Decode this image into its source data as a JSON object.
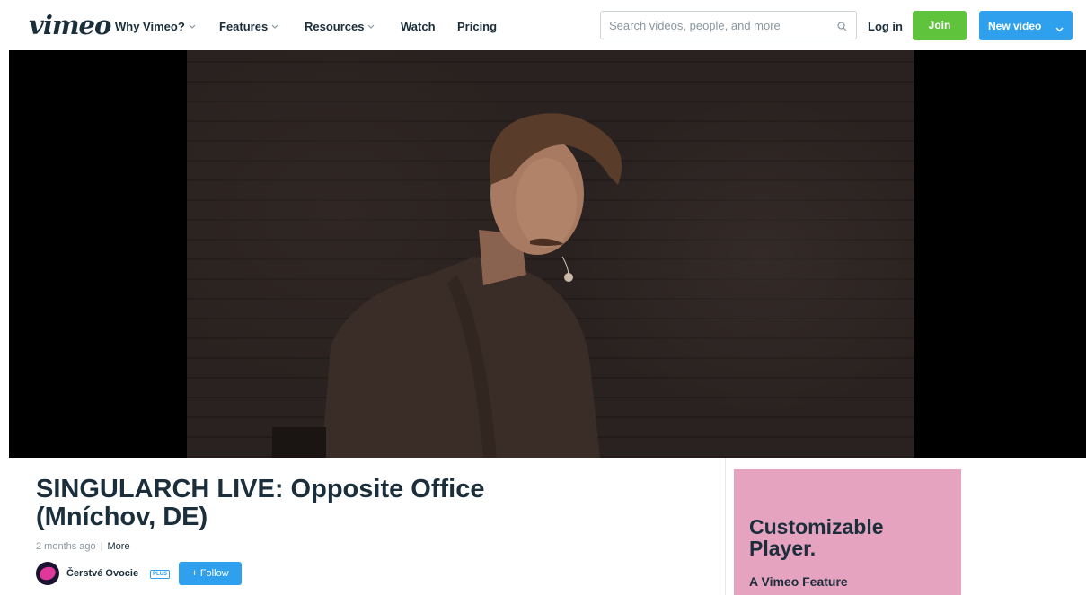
{
  "header": {
    "logo": "vimeo",
    "nav": [
      {
        "label": "Why Vimeo?",
        "dropdown": true
      },
      {
        "label": "Features",
        "dropdown": true
      },
      {
        "label": "Resources",
        "dropdown": true
      },
      {
        "label": "Watch",
        "dropdown": false
      },
      {
        "label": "Pricing",
        "dropdown": false
      }
    ],
    "search": {
      "placeholder": "Search videos, people, and more",
      "value": ""
    },
    "login_label": "Log in",
    "join_label": "Join",
    "new_video_label": "New video"
  },
  "video": {
    "title": "SINGULARCH LIVE: Opposite Office (Mníchov, DE)",
    "posted": "2 months ago",
    "more_label": "More",
    "channel": {
      "name": "Čerstvé Ovocie",
      "badge": "PLUS"
    },
    "follow_label": "+ Follow"
  },
  "ad": {
    "headline": "Customizable Player.",
    "sub": "A Vimeo Feature",
    "background": "#e6a3c0"
  },
  "colors": {
    "join": "#5fc43c",
    "primary": "#2ea0ee",
    "text": "#1a2e3b"
  },
  "icons": [
    "search-icon",
    "chevron-down-icon"
  ]
}
